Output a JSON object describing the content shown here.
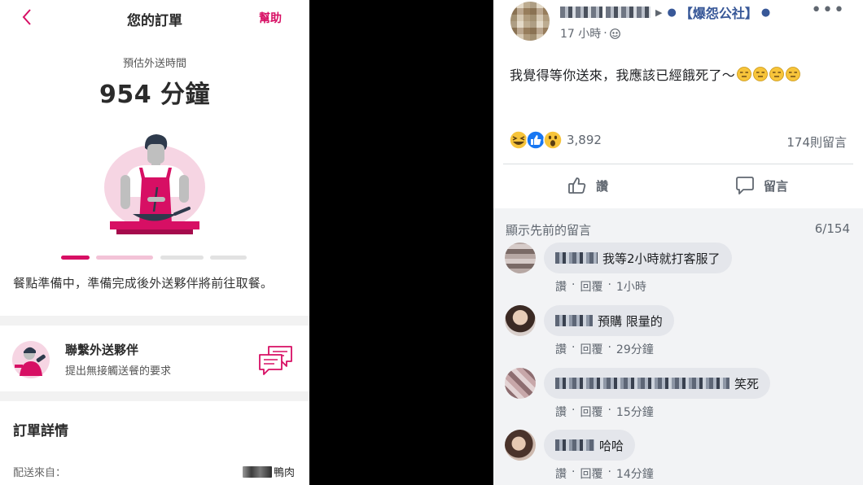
{
  "app": {
    "title": "您的訂單",
    "help_label": "幫助",
    "eta_label": "預估外送時間",
    "eta_value": "954 分鐘",
    "status_message": "餐點準備中，準備完成後外送夥伴將前往取餐。",
    "contact": {
      "title": "聯繫外送夥伴",
      "subtitle": "提出無接觸送餐的要求"
    },
    "order_details_title": "訂單詳情",
    "delivery_from_label": "配送來自：",
    "delivery_from_value": "鴨肉",
    "accent_color": "#d70f64",
    "progress": {
      "steps": 4,
      "current_step": 1
    }
  },
  "post": {
    "group_name": "【爆怨公社】",
    "timestamp": "17 小時",
    "separator": "·",
    "text": "我覺得等你送來，我應該已經餓死了～",
    "reaction_count": "3,892",
    "comment_count": "174則留言",
    "like_label": "讚",
    "comment_label": "留言",
    "more_label": "•••",
    "link_color": "#385898"
  },
  "comments_section": {
    "show_previous": "顯示先前的留言",
    "page_count": "6/154",
    "like_label": "讚",
    "reply_label": "回覆",
    "dot": "·",
    "items": [
      {
        "text": "我等2小時就打客服了",
        "time": "1小時"
      },
      {
        "text": "預購 限量的",
        "time": "29分鐘"
      },
      {
        "text": "笑死",
        "time": "15分鐘"
      },
      {
        "text": "哈哈",
        "time": "14分鐘"
      }
    ]
  }
}
